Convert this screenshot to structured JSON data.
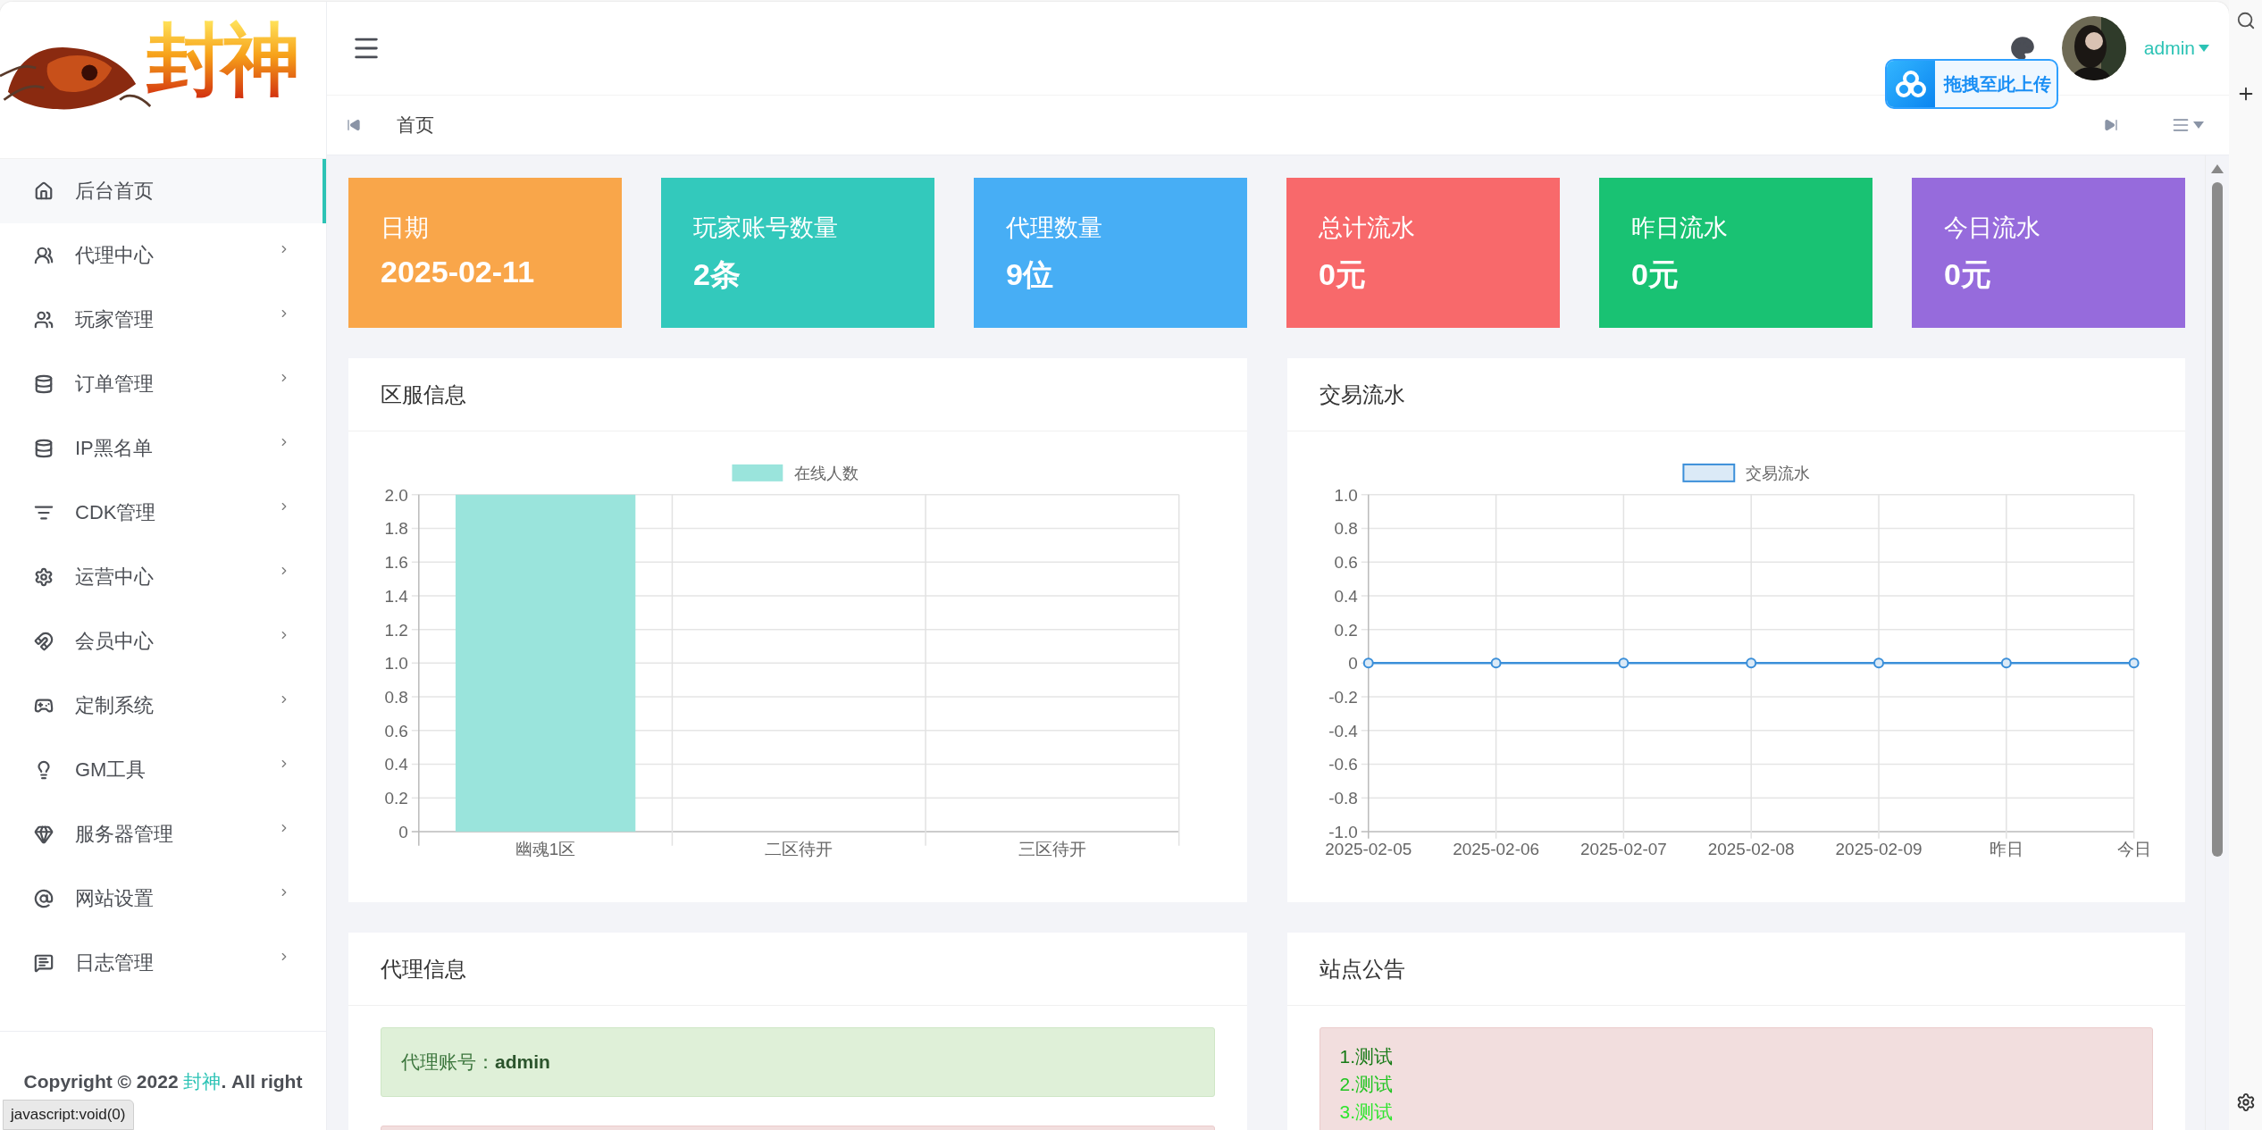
{
  "sidebar": {
    "logo_text": "封神",
    "items": [
      {
        "label": "后台首页",
        "selected": true,
        "submenu": false
      },
      {
        "label": "代理中心",
        "selected": false,
        "submenu": true
      },
      {
        "label": "玩家管理",
        "selected": false,
        "submenu": true
      },
      {
        "label": "订单管理",
        "selected": false,
        "submenu": true
      },
      {
        "label": "IP黑名单",
        "selected": false,
        "submenu": true
      },
      {
        "label": "CDK管理",
        "selected": false,
        "submenu": true
      },
      {
        "label": "运营中心",
        "selected": false,
        "submenu": true
      },
      {
        "label": "会员中心",
        "selected": false,
        "submenu": true
      },
      {
        "label": "定制系统",
        "selected": false,
        "submenu": true
      },
      {
        "label": "GM工具",
        "selected": false,
        "submenu": true
      },
      {
        "label": "服务器管理",
        "selected": false,
        "submenu": true
      },
      {
        "label": "网站设置",
        "selected": false,
        "submenu": true
      },
      {
        "label": "日志管理",
        "selected": false,
        "submenu": true
      }
    ],
    "footer": {
      "before": "Copyright © 2022 ",
      "link": "封神",
      "after": ". All right"
    }
  },
  "header": {
    "user": "admin",
    "upload_hint": "拖拽至此上传"
  },
  "tabs": [
    {
      "label": "首页"
    }
  ],
  "stats": [
    {
      "title": "日期",
      "value": "2025-02-11",
      "color": "#f9a64a"
    },
    {
      "title": "玩家账号数量",
      "value": "2条",
      "color": "#33c9bc"
    },
    {
      "title": "代理数量",
      "value": "9位",
      "color": "#47aef5"
    },
    {
      "title": "总计流水",
      "value": "0元",
      "color": "#f8696b"
    },
    {
      "title": "昨日流水",
      "value": "0元",
      "color": "#19c273"
    },
    {
      "title": "今日流水",
      "value": "0元",
      "color": "#966bdc"
    }
  ],
  "server_info": {
    "title": "区服信息",
    "chart_data": {
      "type": "bar",
      "categories": [
        "幽魂1区",
        "二区待开",
        "三区待开"
      ],
      "grid": true,
      "series": [
        {
          "name": "在线人数",
          "color": "#9ae4dc",
          "values": [
            2,
            0,
            0
          ]
        }
      ],
      "ylim": [
        0,
        2
      ],
      "yticks": [
        0,
        0.2,
        0.4,
        0.6,
        0.8,
        {
          "value": 1,
          "label": "1.0"
        },
        1.2,
        1.4,
        1.6,
        1.8,
        {
          "value": 2,
          "label": "2.0"
        }
      ]
    }
  },
  "transactions": {
    "title": "交易流水",
    "chart_data": {
      "type": "line",
      "categories": [
        "2025-02-05",
        "2025-02-06",
        "2025-02-07",
        "2025-02-08",
        "2025-02-09",
        "昨日",
        "今日"
      ],
      "grid": true,
      "series": [
        {
          "name": "交易流水",
          "color": "#3b8fd9",
          "marker": true,
          "values": [
            0,
            0,
            0,
            0,
            0,
            0,
            0
          ]
        }
      ],
      "ylim": [
        -1,
        1
      ],
      "yticks": [
        {
          "value": -1,
          "label": "-1.0"
        },
        -0.8,
        -0.6,
        -0.4,
        -0.2,
        0,
        0.2,
        0.4,
        0.6,
        0.8,
        {
          "value": 1,
          "label": "1.0"
        }
      ]
    }
  },
  "agent_info": {
    "title": "代理信息",
    "alerts": [
      {
        "kind": "success",
        "text": "代理账号：**admin**"
      },
      {
        "kind": "danger"
      }
    ]
  },
  "announcement": {
    "title": "站点公告",
    "lines": [
      {
        "text": "1.测试",
        "color": "#167a16"
      },
      {
        "text": "2.测试",
        "color": "#22c422"
      },
      {
        "text": "3.测试",
        "color": "#2ee52e"
      }
    ]
  },
  "status_bar": "javascript:void(0)"
}
